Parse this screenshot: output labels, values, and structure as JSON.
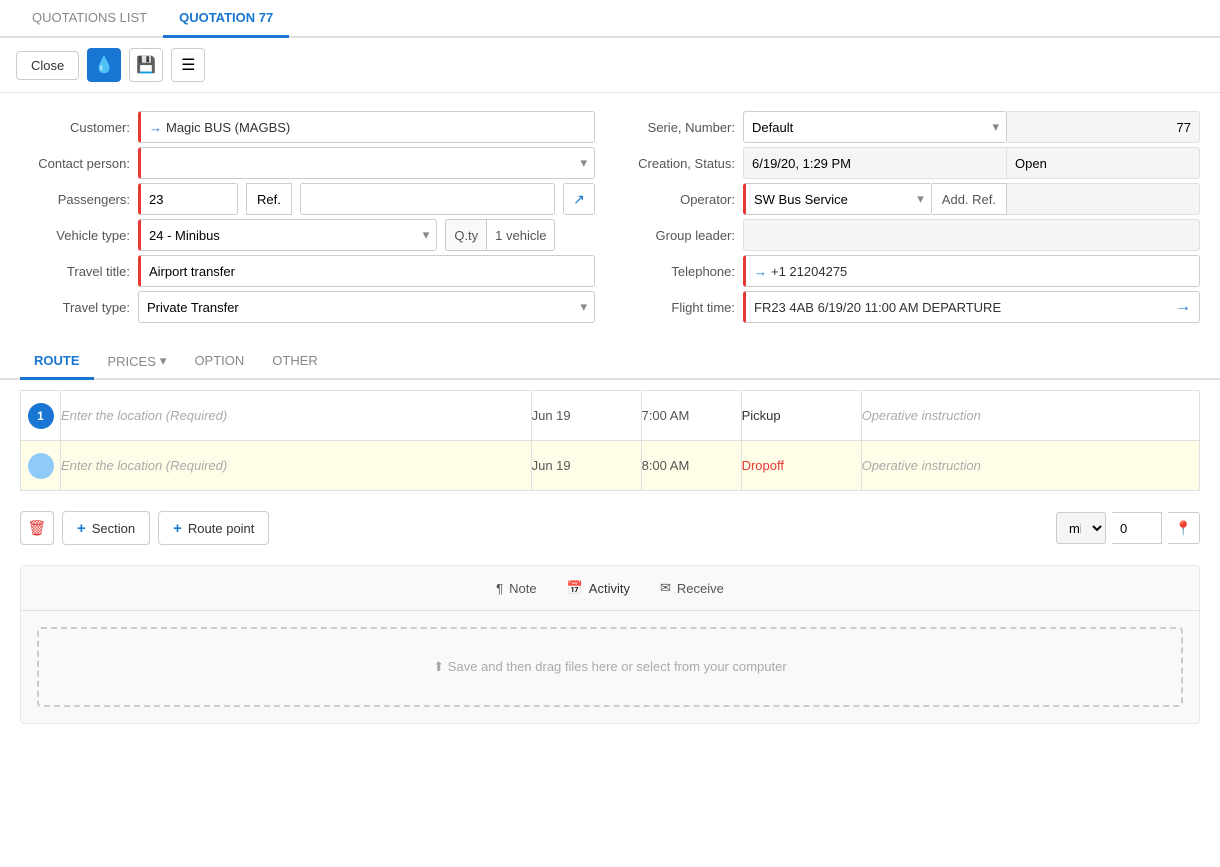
{
  "tabs": {
    "list_tab": "QUOTATIONS LIST",
    "current_tab": "QUOTATION 77"
  },
  "toolbar": {
    "close_label": "Close",
    "drop_icon": "💧",
    "save_icon": "💾",
    "menu_icon": "☰"
  },
  "form": {
    "left": {
      "customer_label": "Customer:",
      "customer_value": "Magic BUS (MAGBS)",
      "contact_label": "Contact person:",
      "contact_placeholder": "",
      "passengers_label": "Passengers:",
      "passengers_value": "23",
      "ref_btn": "Ref.",
      "vehicle_label": "Vehicle type:",
      "vehicle_value": "24 - Minibus",
      "qty_label": "Q.ty",
      "qty_value": "1 vehicle",
      "travel_title_label": "Travel title:",
      "travel_title_value": "Airport transfer",
      "travel_type_label": "Travel type:",
      "travel_type_value": "Private Transfer"
    },
    "right": {
      "serie_label": "Serie, Number:",
      "serie_value": "Default",
      "number_value": "77",
      "creation_label": "Creation, Status:",
      "creation_date": "6/19/20, 1:29 PM",
      "status_value": "Open",
      "operator_label": "Operator:",
      "operator_value": "SW Bus Service",
      "add_ref_label": "Add. Ref.",
      "add_ref_value": "",
      "group_leader_label": "Group leader:",
      "group_leader_value": "",
      "telephone_label": "Telephone:",
      "telephone_value": "+1 21204275",
      "flight_label": "Flight time:",
      "flight_value": "FR23 4AB   6/19/20   11:00 AM   DEPARTURE"
    }
  },
  "inner_tabs": [
    {
      "id": "route",
      "label": "ROUTE",
      "active": true
    },
    {
      "id": "prices",
      "label": "PRICES",
      "active": false,
      "has_arrow": true
    },
    {
      "id": "option",
      "label": "OPTION",
      "active": false
    },
    {
      "id": "other",
      "label": "OTHER",
      "active": false
    }
  ],
  "route": {
    "rows": [
      {
        "stop_num": "1",
        "location_placeholder": "Enter the location (Required)",
        "date": "Jun 19",
        "time": "7:00 AM",
        "type": "Pickup",
        "note_placeholder": "Operative instruction",
        "highlight": false
      },
      {
        "stop_num": "",
        "location_placeholder": "Enter the location (Required)",
        "date": "Jun 19",
        "time": "8:00 AM",
        "type": "Dropoff",
        "note_placeholder": "Operative instruction",
        "highlight": true
      }
    ],
    "unit": "mi",
    "distance": "0"
  },
  "action_buttons": {
    "section_label": "Section",
    "route_point_label": "Route point"
  },
  "bottom": {
    "tabs": [
      {
        "id": "note",
        "label": "Note",
        "icon": "¶",
        "active": false
      },
      {
        "id": "activity",
        "label": "Activity",
        "icon": "📅",
        "active": false
      },
      {
        "id": "receive",
        "label": "Receive",
        "icon": "✉",
        "active": false
      }
    ],
    "upload_text": "Save and then drag files here or select from your computer",
    "upload_icon": "⬆"
  }
}
